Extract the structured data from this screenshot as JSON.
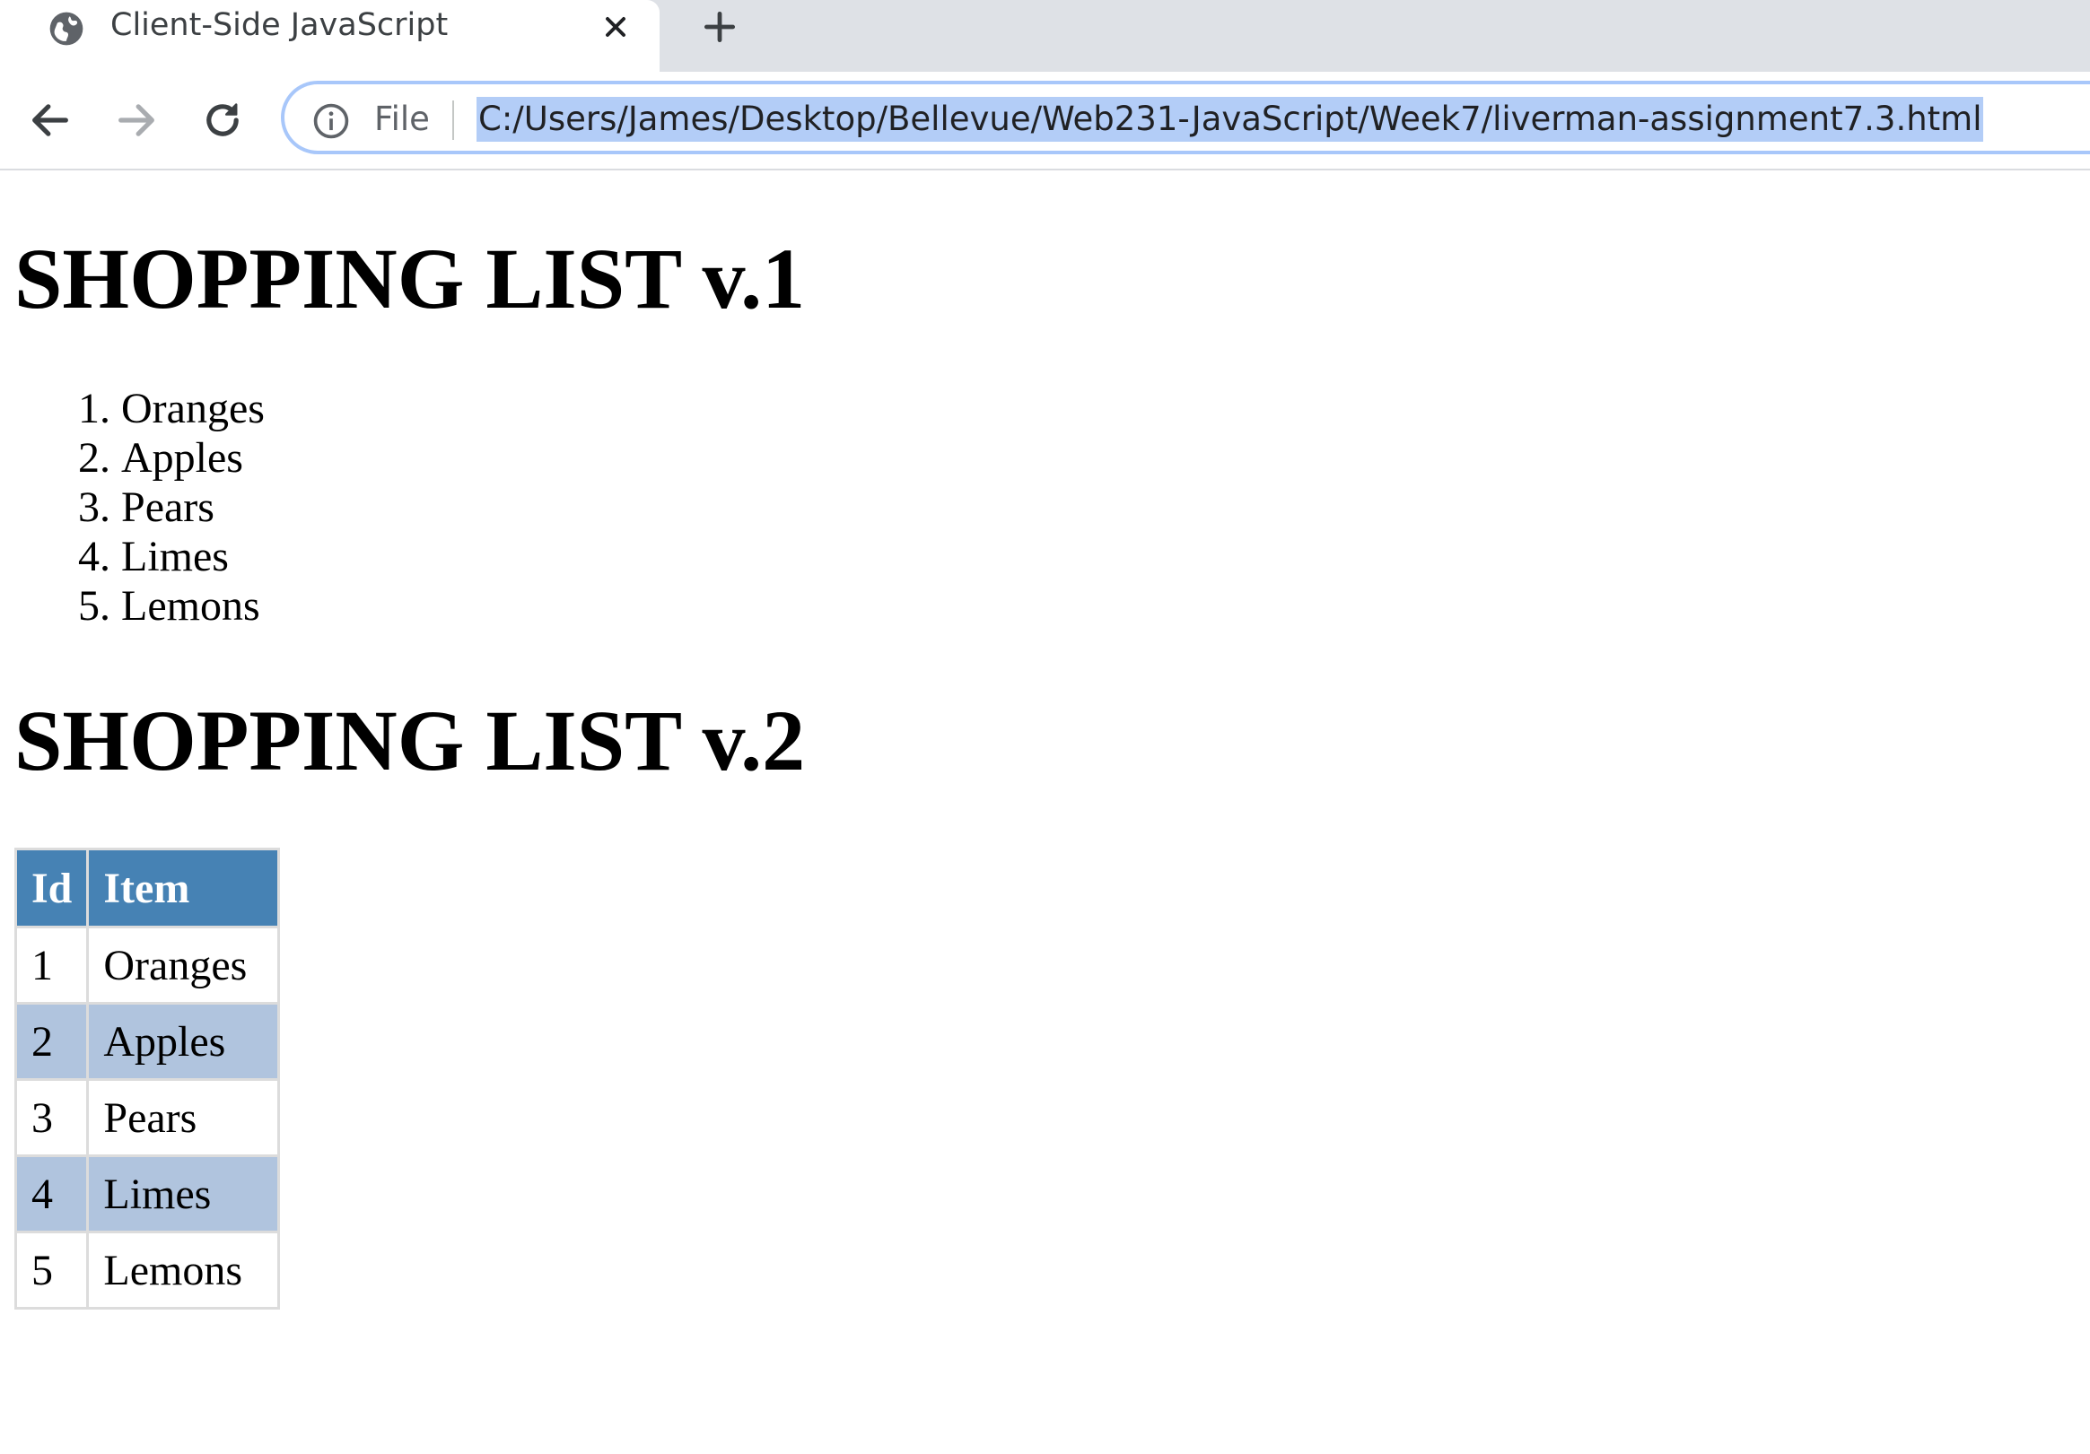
{
  "browser": {
    "tab": {
      "title": "Client-Side JavaScript"
    },
    "toolbar": {
      "scheme_label": "File",
      "url": "C:/Users/James/Desktop/Bellevue/Web231-JavaScript/Week7/liverman-assignment7.3.html"
    }
  },
  "page": {
    "heading_v1": "SHOPPING LIST v.1",
    "list_items": [
      "Oranges",
      "Apples",
      "Pears",
      "Limes",
      "Lemons"
    ],
    "heading_v2": "SHOPPING LIST v.2",
    "table": {
      "headers": [
        "Id",
        "Item"
      ],
      "rows": [
        [
          "1",
          "Oranges"
        ],
        [
          "2",
          "Apples"
        ],
        [
          "3",
          "Pears"
        ],
        [
          "4",
          "Limes"
        ],
        [
          "5",
          "Lemons"
        ]
      ]
    }
  },
  "colors": {
    "table_header_bg": "#4682b4",
    "table_alt_row_bg": "#b0c4de",
    "url_selection_bg": "#b3cdf7",
    "tabstrip_bg": "#dee1e6"
  }
}
